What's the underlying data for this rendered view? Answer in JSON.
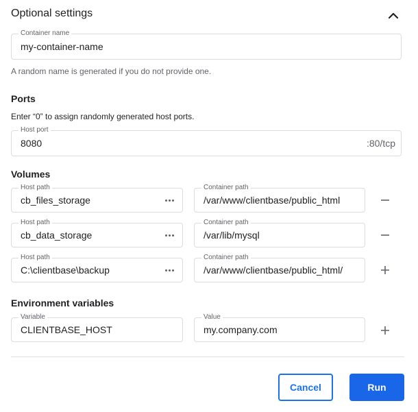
{
  "section": {
    "title": "Optional settings"
  },
  "container_name": {
    "label": "Container name",
    "value": "my-container-name",
    "help": "A random name is generated if you do not provide one."
  },
  "ports": {
    "title": "Ports",
    "description": "Enter “0” to assign randomly generated host ports.",
    "host_port_label": "Host port",
    "host_port_value": "8080",
    "suffix": ":80/tcp"
  },
  "volumes": {
    "title": "Volumes",
    "rows": [
      {
        "host_label": "Host path",
        "host_value": "cb_files_storage",
        "container_label": "Container path",
        "container_value": "/var/www/clientbase/public_html",
        "action": "remove"
      },
      {
        "host_label": "Host path",
        "host_value": "cb_data_storage",
        "container_label": "Container path",
        "container_value": "/var/lib/mysql",
        "action": "remove"
      },
      {
        "host_label": "Host path",
        "host_value": "C:\\clientbase\\backup",
        "container_label": "Container path",
        "container_value": "/var/www/clientbase/public_html/",
        "action": "add"
      }
    ]
  },
  "env": {
    "title": "Environment variables",
    "variable_label": "Variable",
    "variable_value": "CLIENTBASE_HOST",
    "value_label": "Value",
    "value_value": "my.company.com"
  },
  "footer": {
    "cancel_label": "Cancel",
    "run_label": "Run"
  },
  "colors": {
    "accent": "#1a73e8",
    "run_bg": "#1a66e8",
    "border": "#dadce0"
  },
  "icons": {
    "collapse": "chevron-up-icon",
    "more": "more-horizontal-icon",
    "remove": "minus-icon",
    "add": "plus-icon"
  }
}
